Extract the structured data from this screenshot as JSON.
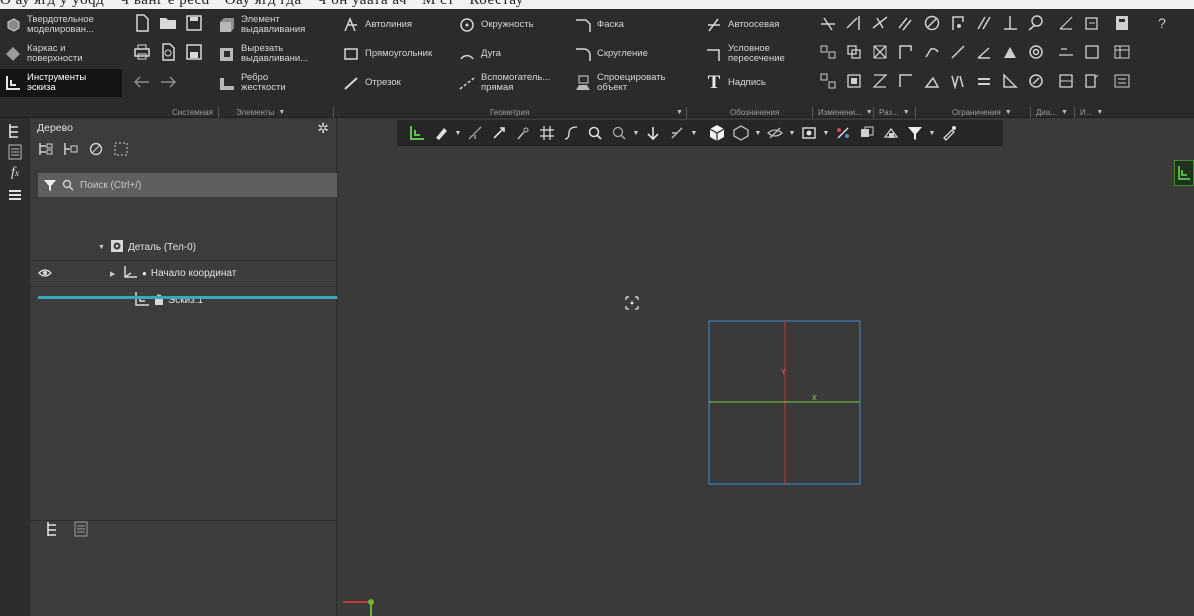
{
  "caption": {
    "text": "О ау ягд у уoqд \" Ч ванг е pecd \" Оау ягд гда \" Ч он уаата ач \" М ст \" Коестау"
  },
  "ribbon": {
    "col1": [
      {
        "label": "Твердотельное\nмоделирован...",
        "icon": "solid-modeling-icon"
      },
      {
        "label": "Каркас и\nповерхности",
        "icon": "surface-icon"
      },
      {
        "label": "Инструменты\nэскиза",
        "icon": "sketch-tools-icon"
      }
    ],
    "system_tools": [
      "new-file-icon",
      "open-folder-icon",
      "save-icon",
      "print-icon",
      "preview-icon",
      "save-as-icon",
      "undo-icon",
      "redo-icon"
    ],
    "elements": [
      {
        "label": "Элемент\nвыдавливания",
        "icon": "extrude-icon"
      },
      {
        "label": "Вырезать\nвыдавливани...",
        "icon": "cut-extrude-icon"
      },
      {
        "label": "Ребро\nжесткости",
        "icon": "rib-icon"
      }
    ],
    "geometry": [
      {
        "label": "Автолиния",
        "icon": "autoline-icon"
      },
      {
        "label": "Прямоугольник",
        "icon": "rectangle-icon"
      },
      {
        "label": "Отрезок",
        "icon": "segment-icon"
      },
      {
        "label": "Окружность",
        "icon": "circle-icon"
      },
      {
        "label": "Дуга",
        "icon": "arc-icon"
      },
      {
        "label": "Вспомогатель...\nпрямая",
        "icon": "aux-line-icon"
      },
      {
        "label": "Фаска",
        "icon": "chamfer-icon"
      },
      {
        "label": "Скругление",
        "icon": "fillet-icon"
      },
      {
        "label": "Спроецировать\nобъект",
        "icon": "project-icon"
      }
    ],
    "designations": [
      {
        "label": "Автоосевая",
        "icon": "autoaxis-icon"
      },
      {
        "label": "Условное\nпересечение",
        "icon": "intersection-icon"
      },
      {
        "label": "Надпись",
        "icon": "text-icon"
      }
    ],
    "groups": [
      {
        "label": "Системная",
        "dropdown": false
      },
      {
        "label": "Элементы",
        "dropdown": true
      },
      {
        "label": "Геометрия",
        "dropdown": true
      },
      {
        "label": "Обозначения",
        "dropdown": false
      },
      {
        "label": "Изменени...",
        "dropdown": true
      },
      {
        "label": "Раз...",
        "dropdown": true
      },
      {
        "label": "Ограничения",
        "dropdown": true
      },
      {
        "label": "Диа...",
        "dropdown": true
      },
      {
        "label": "И...",
        "dropdown": true
      }
    ]
  },
  "tree": {
    "title": "Дерево",
    "search_placeholder": "Поиск (Ctrl+/)",
    "items": [
      {
        "label": "Деталь (Тел-0)",
        "expanded": true
      },
      {
        "label": "Начало координат",
        "expanded": false
      },
      {
        "label": "Эскиз:1"
      }
    ]
  },
  "viewport": {
    "axis_x": "X",
    "axis_y": "Y"
  },
  "colors": {
    "accent_teal": "#38a9b6",
    "sketch_blue": "#3f7fb8",
    "axis_green": "#6fb33a",
    "axis_red": "#c23b3b",
    "badge_green": "#3d8a2e"
  }
}
